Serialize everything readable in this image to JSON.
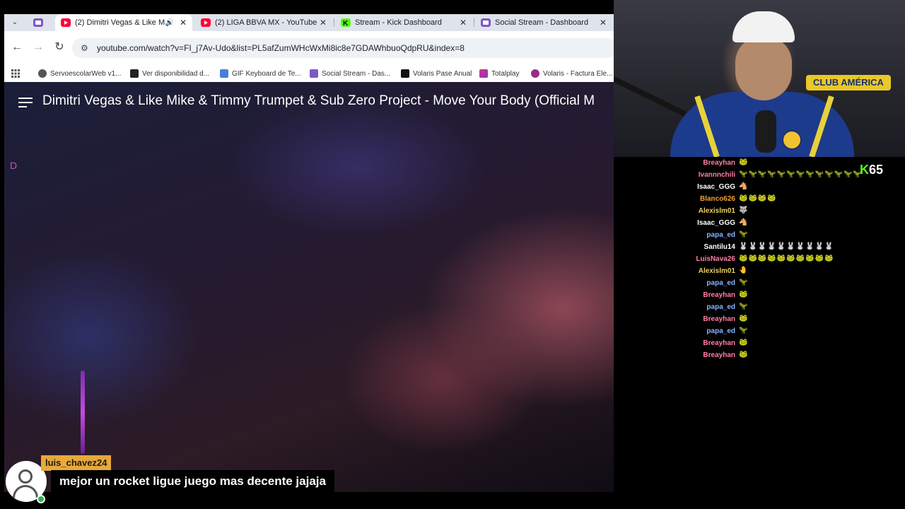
{
  "browser": {
    "tabs": [
      {
        "label": "(2) Dimitri Vegas & Like Mi",
        "favicon": "youtube-icon",
        "active": true,
        "audio": true
      },
      {
        "label": "(2) LIGA BBVA MX - YouTube",
        "favicon": "youtube-icon",
        "active": false
      },
      {
        "label": "Stream - Kick Dashboard",
        "favicon": "kick-icon",
        "active": false
      },
      {
        "label": "Social Stream - Dashboard",
        "favicon": "social-stream-icon",
        "active": false
      }
    ],
    "url": "youtube.com/watch?v=FI_j7Av-Udo&list=PL5afZumWHcWxMi8ic8e7GDAWhbuoQdpRU&index=8",
    "bookmarks": [
      "ServoescolarWeb v1...",
      "Ver disponibilidad d...",
      "GIF Keyboard de Te...",
      "Social Stream - Das...",
      "Volaris Pase Anual",
      "Totalplay",
      "Volaris - Factura Ele..."
    ]
  },
  "video": {
    "title": "Dimitri Vegas & Like Mike & Timmy Trumpet & Sub Zero Project - Move Your Body (Official M",
    "overlay_char": "D"
  },
  "webcam": {
    "banner": "CLUB AMÉRICA"
  },
  "chat": {
    "messages": [
      {
        "user": "Breayhan",
        "color": "#ff7ea0",
        "emotes": "🐸"
      },
      {
        "user": "Ivannnchili",
        "color": "#ff7ea0",
        "emotes": "🦖🦖🦖🦖🦖🦖🦖🦖🦖🦖🦖🦖🦖"
      },
      {
        "user": "Isaac_GGG",
        "color": "#ffffff",
        "emotes": "🐴"
      },
      {
        "user": "Blanco626",
        "color": "#f0a030",
        "emotes": "🐸🐸🐸🐸"
      },
      {
        "user": "Alexislm01",
        "color": "#f0d060",
        "emotes": "🐺"
      },
      {
        "user": "Isaac_GGG",
        "color": "#ffffff",
        "emotes": "🐴"
      },
      {
        "user": "papa_ed",
        "color": "#8ab4ff",
        "emotes": "🦖"
      },
      {
        "user": "Santilu14",
        "color": "#ffffff",
        "emotes": "🐰🐰🐰🐰🐰🐰🐰🐰🐰🐰"
      },
      {
        "user": "LuisNava26",
        "color": "#ff7ea0",
        "emotes": "🐸🐸🐸🐸🐸🐸🐸🐸🐸🐸"
      },
      {
        "user": "Alexislm01",
        "color": "#f0d060",
        "emotes": "🤚"
      },
      {
        "user": "papa_ed",
        "color": "#8ab4ff",
        "emotes": "🦖"
      },
      {
        "user": "Breayhan",
        "color": "#ff7ea0",
        "emotes": "🐸"
      },
      {
        "user": "papa_ed",
        "color": "#8ab4ff",
        "emotes": "🦖"
      },
      {
        "user": "Breayhan",
        "color": "#ff7ea0",
        "emotes": "🐸"
      },
      {
        "user": "papa_ed",
        "color": "#8ab4ff",
        "emotes": "🦖"
      },
      {
        "user": "Breayhan",
        "color": "#ff7ea0",
        "emotes": "🐸"
      },
      {
        "user": "Breayhan",
        "color": "#ff7ea0",
        "emotes": "🐸"
      }
    ],
    "kick_counter": "65"
  },
  "highlight": {
    "user": "luis_chavez24",
    "message": "mejor un rocket ligue juego mas decente jajaja"
  },
  "colors": {
    "youtube_red": "#ff0033",
    "kick_green": "#53fc18",
    "label_orange": "#e8a93a"
  }
}
